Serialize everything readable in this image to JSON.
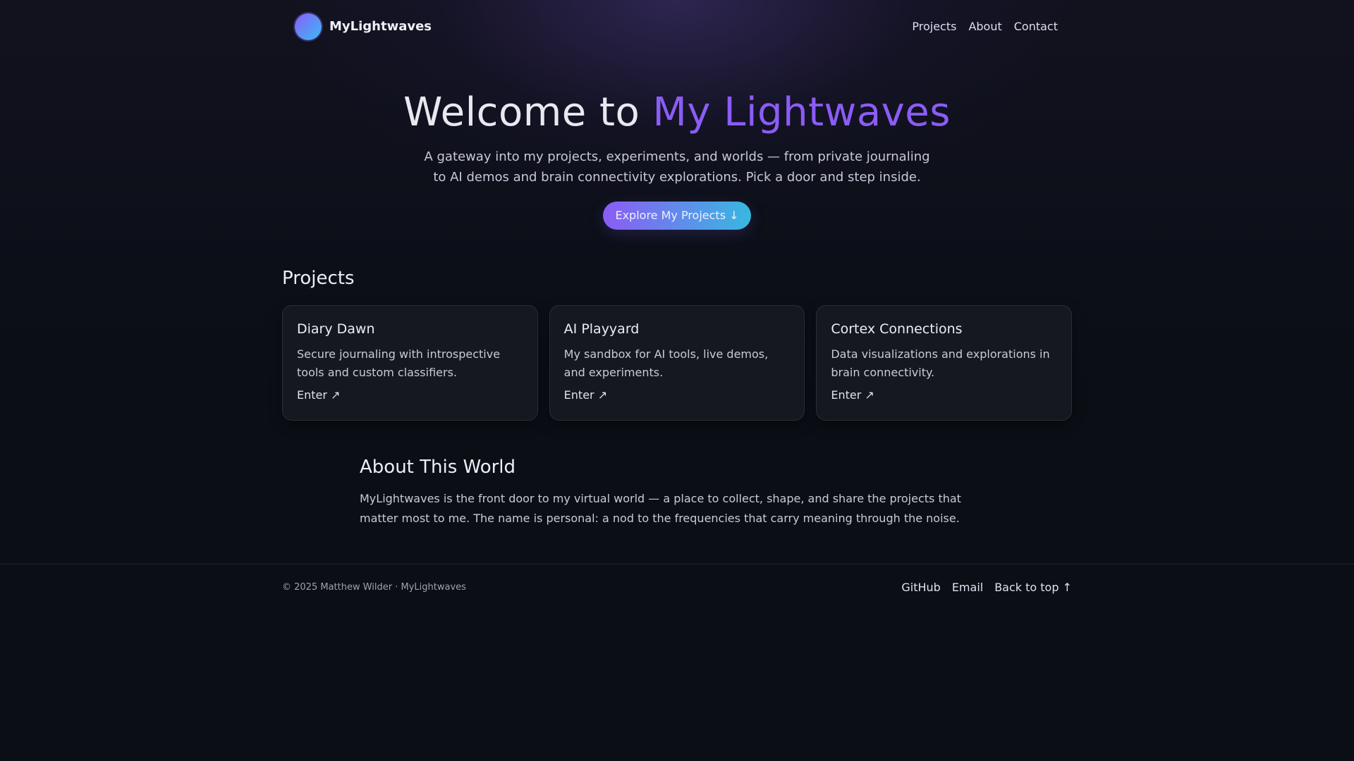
{
  "header": {
    "brand": "MyLightwaves",
    "nav": [
      "Projects",
      "About",
      "Contact"
    ]
  },
  "hero": {
    "title_prefix": "Welcome to ",
    "title_accent": "My Lightwaves",
    "subtitle": "A gateway into my projects, experiments, and worlds — from private journaling to AI demos and brain connectivity explorations. Pick a door and step inside.",
    "cta_label": "Explore My Projects ↓"
  },
  "projects": {
    "title": "Projects",
    "items": [
      {
        "title": "Diary Dawn",
        "description": "Secure journaling with introspective tools and custom classifiers.",
        "link": "Enter ↗"
      },
      {
        "title": "AI Playyard",
        "description": "My sandbox for AI tools, live demos, and experiments.",
        "link": "Enter ↗"
      },
      {
        "title": "Cortex Connections",
        "description": "Data visualizations and explorations in brain connectivity.",
        "link": "Enter ↗"
      }
    ]
  },
  "about": {
    "title": "About This World",
    "text": "MyLightwaves is the front door to my virtual world — a place to collect, shape, and share the projects that matter most to me. The name is personal: a nod to the frequencies that carry meaning through the noise."
  },
  "footer": {
    "copyright": "© 2025 Matthew Wilder · MyLightwaves",
    "links": [
      "GitHub",
      "Email",
      "Back to top ↑"
    ]
  },
  "colors": {
    "accent": "#8b5cf6",
    "accent_secondary": "#38bdf8",
    "background": "#0b0e15",
    "card": "#15181f"
  }
}
